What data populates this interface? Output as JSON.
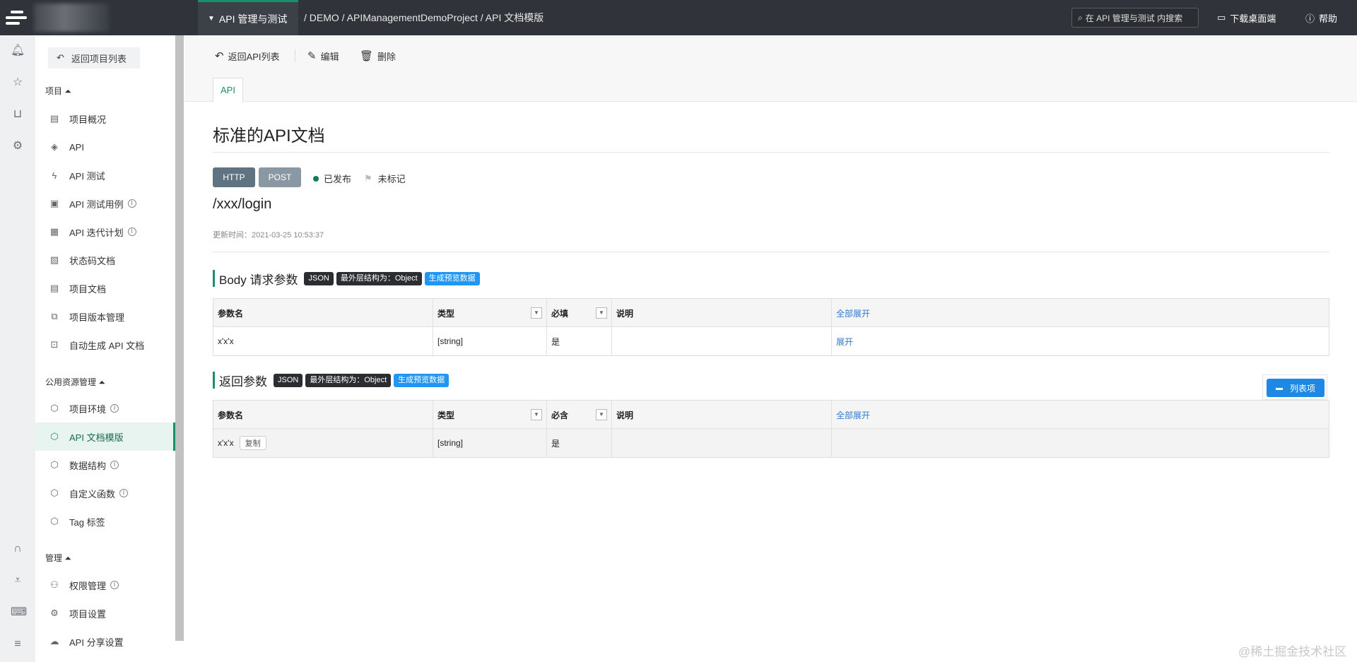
{
  "topbar": {
    "module": "API 管理与测试",
    "breadcrumb": "/ DEMO / APIManagementDemoProject / API 文档模版",
    "search_placeholder": "在 API 管理与测试 内搜索",
    "download": "下载桌面端",
    "help": "帮助"
  },
  "sidebar": {
    "back": "返回项目列表",
    "section_project": "项目",
    "section_public": "公用资源管理",
    "section_admin": "管理",
    "items": [
      {
        "label": "项目概况"
      },
      {
        "label": "API"
      },
      {
        "label": "API 测试"
      },
      {
        "label": "API 测试用例"
      },
      {
        "label": "API 迭代计划"
      },
      {
        "label": "状态码文档"
      },
      {
        "label": "项目文档"
      },
      {
        "label": "项目版本管理"
      },
      {
        "label": "自动生成 API 文档"
      },
      {
        "label": "项目环境"
      },
      {
        "label": "API 文档模版"
      },
      {
        "label": "数据结构"
      },
      {
        "label": "自定义函数"
      },
      {
        "label": "Tag 标签"
      },
      {
        "label": "权限管理"
      },
      {
        "label": "项目设置"
      },
      {
        "label": "API 分享设置"
      }
    ]
  },
  "toolbar": {
    "back": "返回API列表",
    "edit": "编辑",
    "delete": "删除",
    "tab": "API"
  },
  "doc": {
    "title": "标准的API文档",
    "protocol": "HTTP",
    "method": "POST",
    "status": "已发布",
    "flag": "未标记",
    "path": "/xxx/login",
    "updated": "更新时间：2021-03-25 10:53:37"
  },
  "body_section": {
    "title": "Body 请求参数",
    "chip_json": "JSON",
    "chip_struct": "最外层结构为：Object",
    "chip_preview": "生成预览数据",
    "headers": {
      "name": "参数名",
      "type": "类型",
      "required": "必填",
      "desc": "说明",
      "expand_all": "全部展开"
    },
    "row": {
      "name": "x'x'x",
      "type": "[string]",
      "required": "是",
      "desc": "",
      "expand": "展开"
    }
  },
  "return_section": {
    "title": "返回参数",
    "chip_json": "JSON",
    "chip_struct": "最外层结构为：Object",
    "chip_preview": "生成预览数据",
    "list_button": "列表项",
    "headers": {
      "name": "参数名",
      "type": "类型",
      "required": "必含",
      "desc": "说明",
      "expand_all": "全部展开"
    },
    "row": {
      "name": "x'x'x",
      "copy": "复制",
      "type": "[string]",
      "required": "是",
      "desc": ""
    }
  },
  "watermark": "@稀土掘金技术社区",
  "icons": {
    "logo": "logo-icon",
    "bell": "bell-icon",
    "star": "star-icon",
    "shirt": "shirt-icon",
    "gear": "gear-icon",
    "headset": "headset-icon",
    "download": "download-icon",
    "keyboard": "keyboard-icon",
    "menu": "menu-icon"
  }
}
